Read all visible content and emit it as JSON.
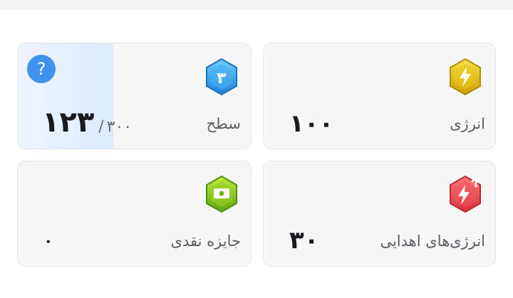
{
  "cards": {
    "energy": {
      "label": "انرژی",
      "value": "۱۰۰",
      "icon": "lightning-gold-badge-icon",
      "color": "#d9b400"
    },
    "level": {
      "label": "سطح",
      "badge_number": "۳",
      "current": "۱۲۳",
      "separator": "/",
      "max": "۳۰۰",
      "progress": 0.41,
      "icon": "level-blue-badge-icon",
      "color": "#3ba4f0"
    },
    "donated": {
      "label": "انرژی‌های اهدایی",
      "value": "۳۰",
      "icon": "donated-energy-red-badge-icon",
      "color": "#e8474c"
    },
    "prize": {
      "label": "جایزه نقدی",
      "value": "۰",
      "icon": "cash-green-badge-icon",
      "color": "#86c51f"
    }
  },
  "help": {
    "glyph": "?",
    "color": "#3f93ee"
  }
}
